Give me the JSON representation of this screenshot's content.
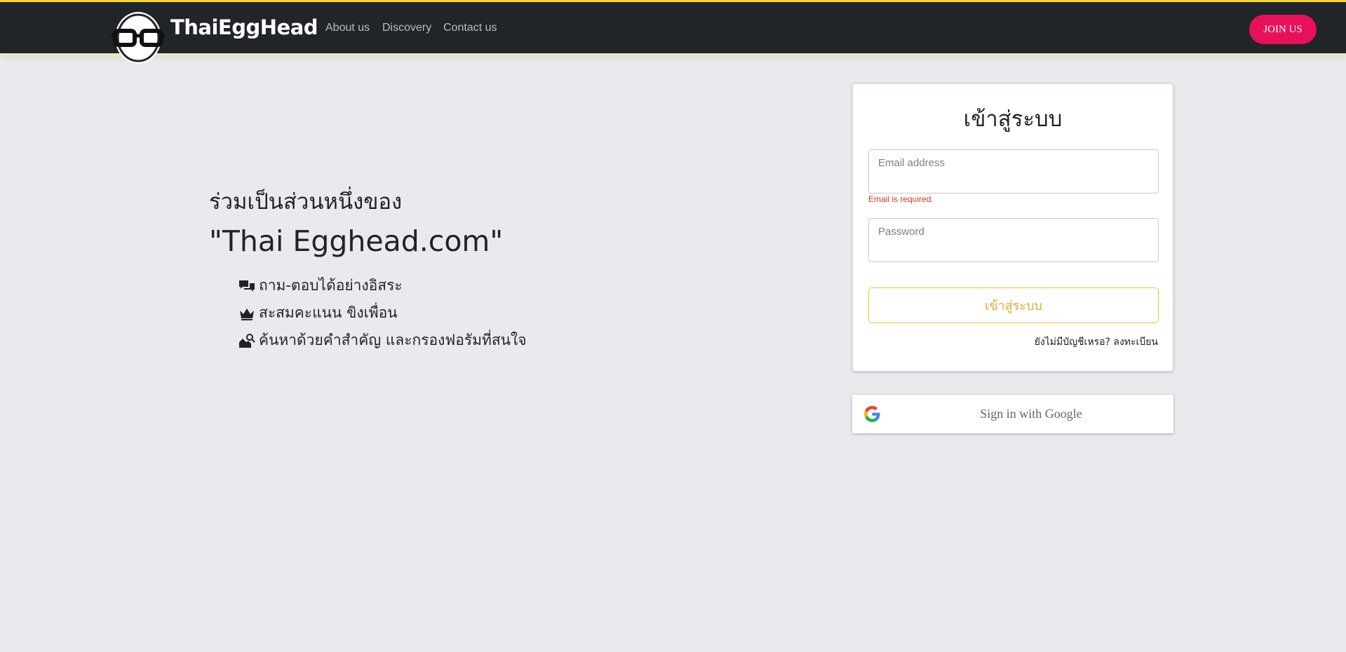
{
  "nav": {
    "brand": "ThaiEggHead",
    "links": [
      "About us",
      "Discovery",
      "Contact us"
    ],
    "join_label": "JOIN US"
  },
  "hero": {
    "subtitle": "ร่วมเป็นส่วนหนึ่งของ",
    "title": "\"Thai Egghead.com\"",
    "features": [
      {
        "icon": "chat-bubbles-icon",
        "text": "ถาม-ตอบได้อย่างอิสระ"
      },
      {
        "icon": "crown-icon",
        "text": "สะสมคะแนน ขิงเพื่อน"
      },
      {
        "icon": "search-filter-icon",
        "text": "ค้นหาด้วยคำสำคัญ และกรองฟอรัมที่สนใจ"
      }
    ]
  },
  "login": {
    "title": "เข้าสู่ระบบ",
    "email_placeholder": "Email address",
    "email_value": "",
    "email_error": "Email is required.",
    "password_placeholder": "Password",
    "password_value": "",
    "submit_label": "เข้าสู่ระบบ",
    "register_text": "ยังไม่มีบัญชีเหรอ? ลงทะเบียน"
  },
  "google": {
    "label": "Sign in with Google",
    "icon": "google-g-icon"
  },
  "colors": {
    "navbar_bg": "#212429",
    "accent_yellow": "#f5d328",
    "join_pink": "#e8105a",
    "page_bg": "#e9eaee",
    "error_red": "#e0341c",
    "button_gold": "#e3a92a"
  }
}
